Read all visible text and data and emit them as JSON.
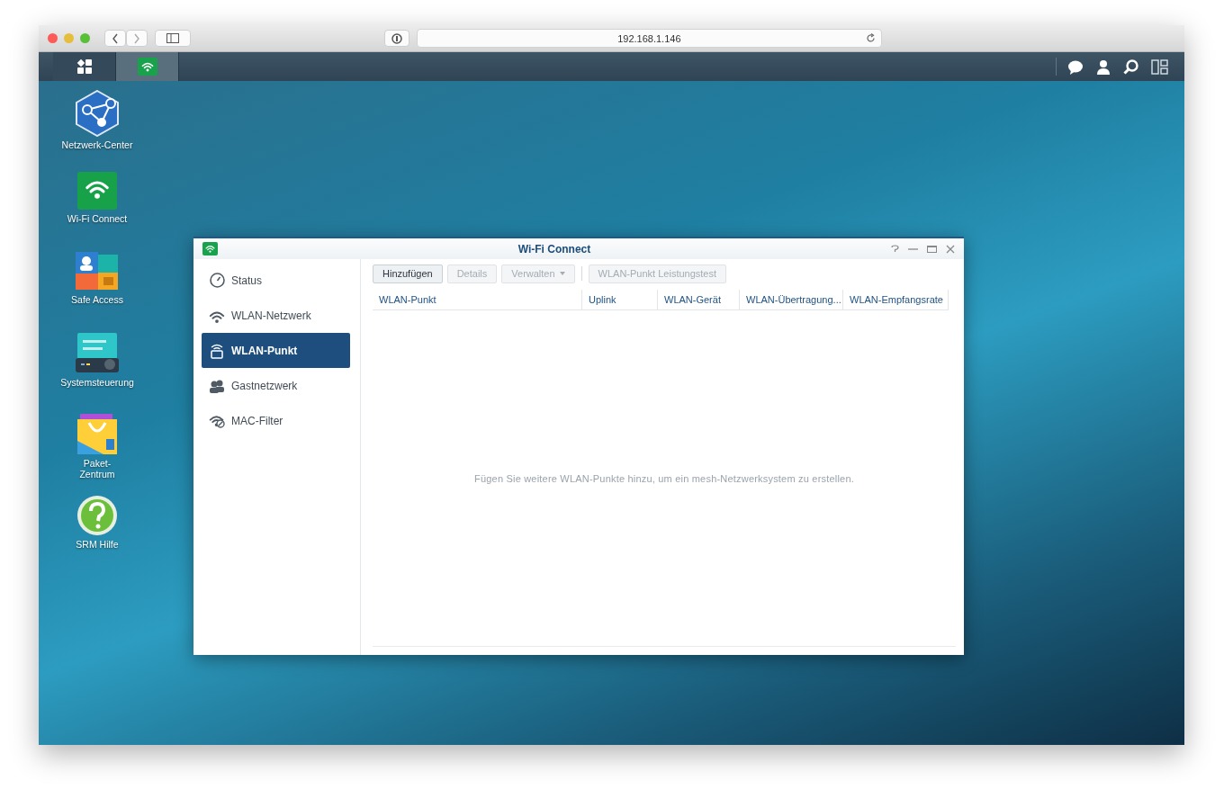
{
  "browser": {
    "url": "192.168.1.146"
  },
  "taskbar": {
    "apps": [
      {
        "kind": "main-menu",
        "selected": false
      },
      {
        "kind": "wifi",
        "selected": true
      }
    ]
  },
  "desktop_icons": [
    {
      "kind": "network",
      "label": "Netzwerk-Center"
    },
    {
      "kind": "wifi",
      "label": "Wi-Fi Connect"
    },
    {
      "kind": "safe",
      "label": "Safe Access"
    },
    {
      "kind": "control",
      "label": "Systemsteuerung"
    },
    {
      "kind": "package",
      "label": "Paket-\nZentrum"
    },
    {
      "kind": "help",
      "label": "SRM Hilfe"
    }
  ],
  "window": {
    "title": "Wi-Fi Connect",
    "sidebar": [
      {
        "kind": "gauge",
        "label": "Status",
        "selected": false
      },
      {
        "kind": "wifi",
        "label": "WLAN-Netzwerk",
        "selected": false
      },
      {
        "kind": "router",
        "label": "WLAN-Punkt",
        "selected": true
      },
      {
        "kind": "guests",
        "label": "Gastnetzwerk",
        "selected": false
      },
      {
        "kind": "filter",
        "label": "MAC-Filter",
        "selected": false
      }
    ],
    "toolbar": [
      {
        "kind": "button",
        "label": "Hinzufügen",
        "disabled": false
      },
      {
        "kind": "button",
        "label": "Details",
        "disabled": true
      },
      {
        "kind": "dropdown",
        "label": "Verwalten",
        "disabled": true
      },
      {
        "kind": "separator"
      },
      {
        "kind": "button",
        "label": "WLAN-Punkt Leistungstest",
        "disabled": true
      }
    ],
    "columns": [
      "WLAN-Punkt",
      "Uplink",
      "WLAN-Gerät",
      "WLAN-Übertragung...",
      "WLAN-Empfangsrate"
    ],
    "empty_message": "Fügen Sie weitere WLAN-Punkte hinzu, um ein mesh-Netzwerksystem zu erstellen."
  }
}
